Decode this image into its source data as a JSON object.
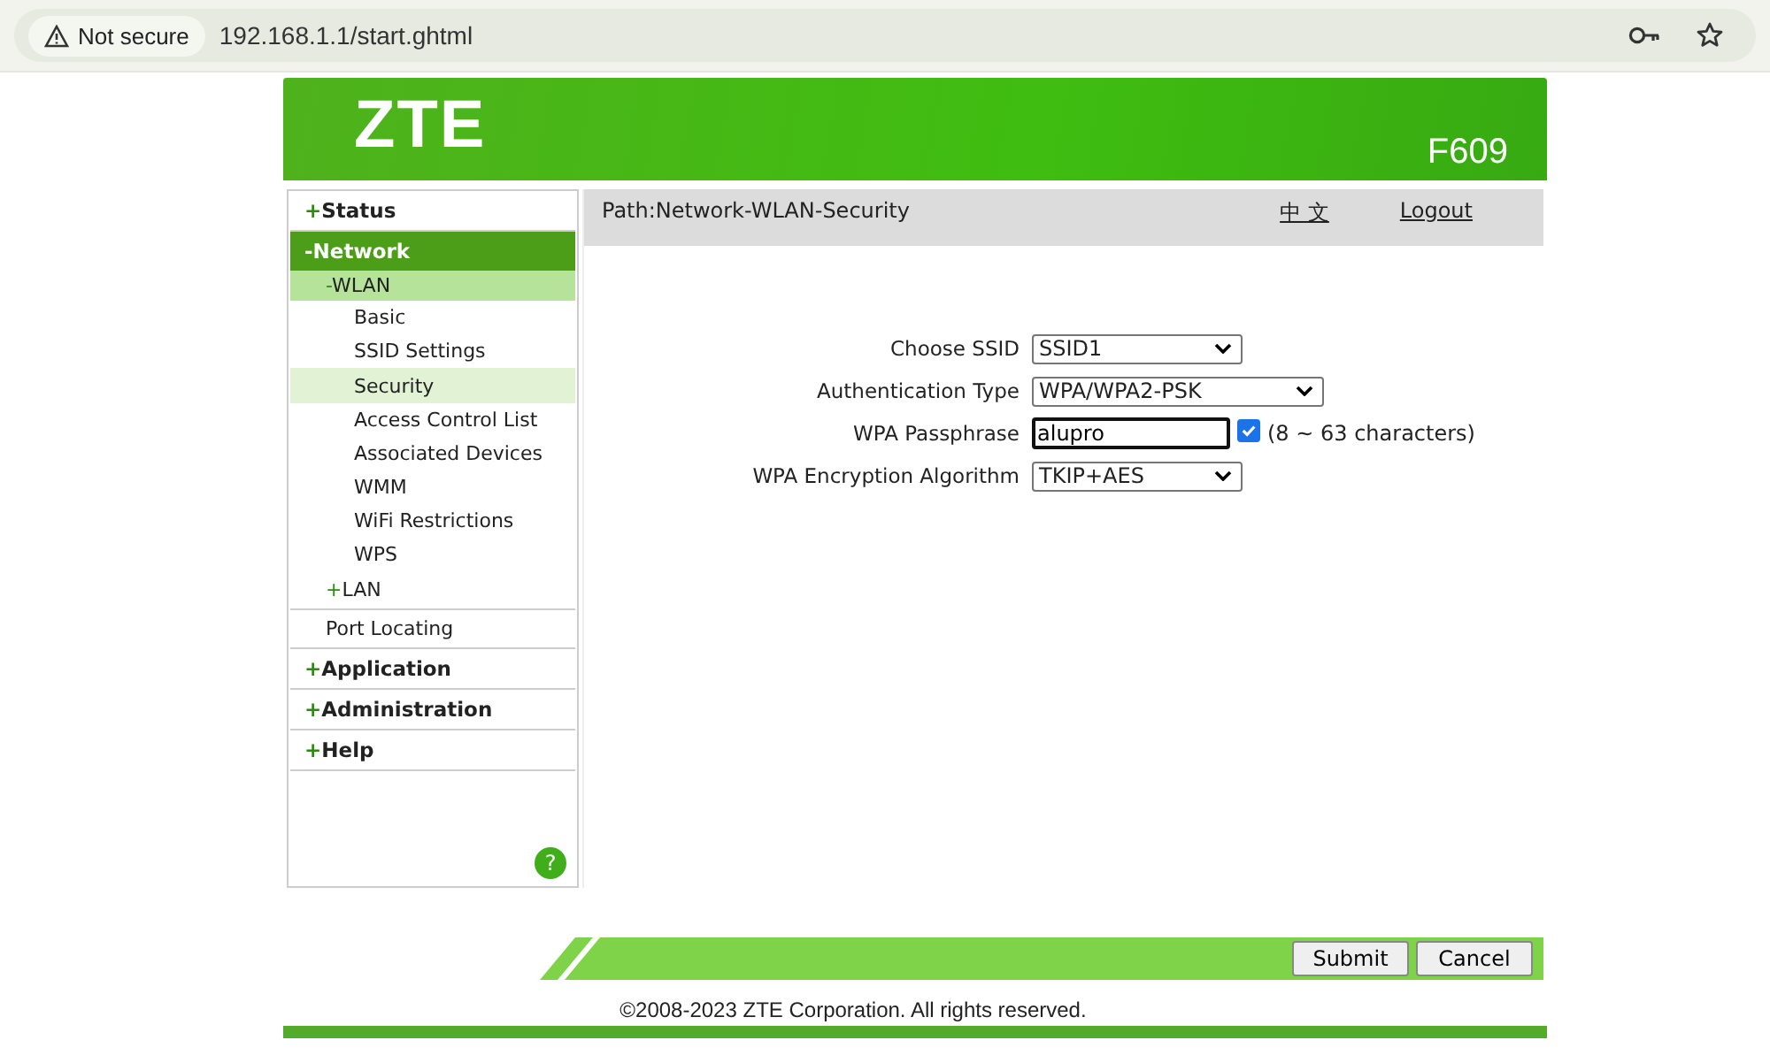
{
  "browser": {
    "security": "Not secure",
    "url": "192.168.1.1/start.ghtml"
  },
  "header": {
    "logo": "ZTE",
    "model": "F609"
  },
  "sidebar": {
    "items": [
      {
        "sign": "+",
        "label": "Status",
        "selected": false
      },
      {
        "sign": "-",
        "label": "Network",
        "selected": true,
        "children": [
          {
            "sign": "-",
            "label": "WLAN",
            "selected": true,
            "children": [
              {
                "label": "Basic",
                "selected": false
              },
              {
                "label": "SSID Settings",
                "selected": false
              },
              {
                "label": "Security",
                "selected": true
              },
              {
                "label": "Access Control List",
                "selected": false
              },
              {
                "label": "Associated Devices",
                "selected": false
              },
              {
                "label": "WMM",
                "selected": false
              },
              {
                "label": "WiFi Restrictions",
                "selected": false
              },
              {
                "label": "WPS",
                "selected": false
              }
            ]
          },
          {
            "sign": "+",
            "label": "LAN",
            "selected": false
          },
          {
            "label": "Port Locating",
            "selected": false
          }
        ]
      },
      {
        "sign": "+",
        "label": "Application",
        "selected": false
      },
      {
        "sign": "+",
        "label": "Administration",
        "selected": false
      },
      {
        "sign": "+",
        "label": "Help",
        "selected": false
      }
    ],
    "help": "?"
  },
  "content": {
    "path": "Path:Network-WLAN-Security",
    "language": "中 文",
    "logout": "Logout",
    "fields": [
      {
        "kind": "select",
        "label": "Choose SSID",
        "value": "SSID1",
        "wide": false
      },
      {
        "kind": "select",
        "label": "Authentication Type",
        "value": "WPA/WPA2-PSK",
        "wide": true
      },
      {
        "kind": "password",
        "label": "WPA Passphrase",
        "value": "alupro",
        "checked": true,
        "hint": "(8 ~ 63 characters)"
      },
      {
        "kind": "select",
        "label": "WPA Encryption Algorithm",
        "value": "TKIP+AES",
        "wide": false
      }
    ]
  },
  "buttons": [
    "Submit",
    "Cancel"
  ],
  "copyright": "©2008-2023 ZTE Corporation. All rights reserved."
}
